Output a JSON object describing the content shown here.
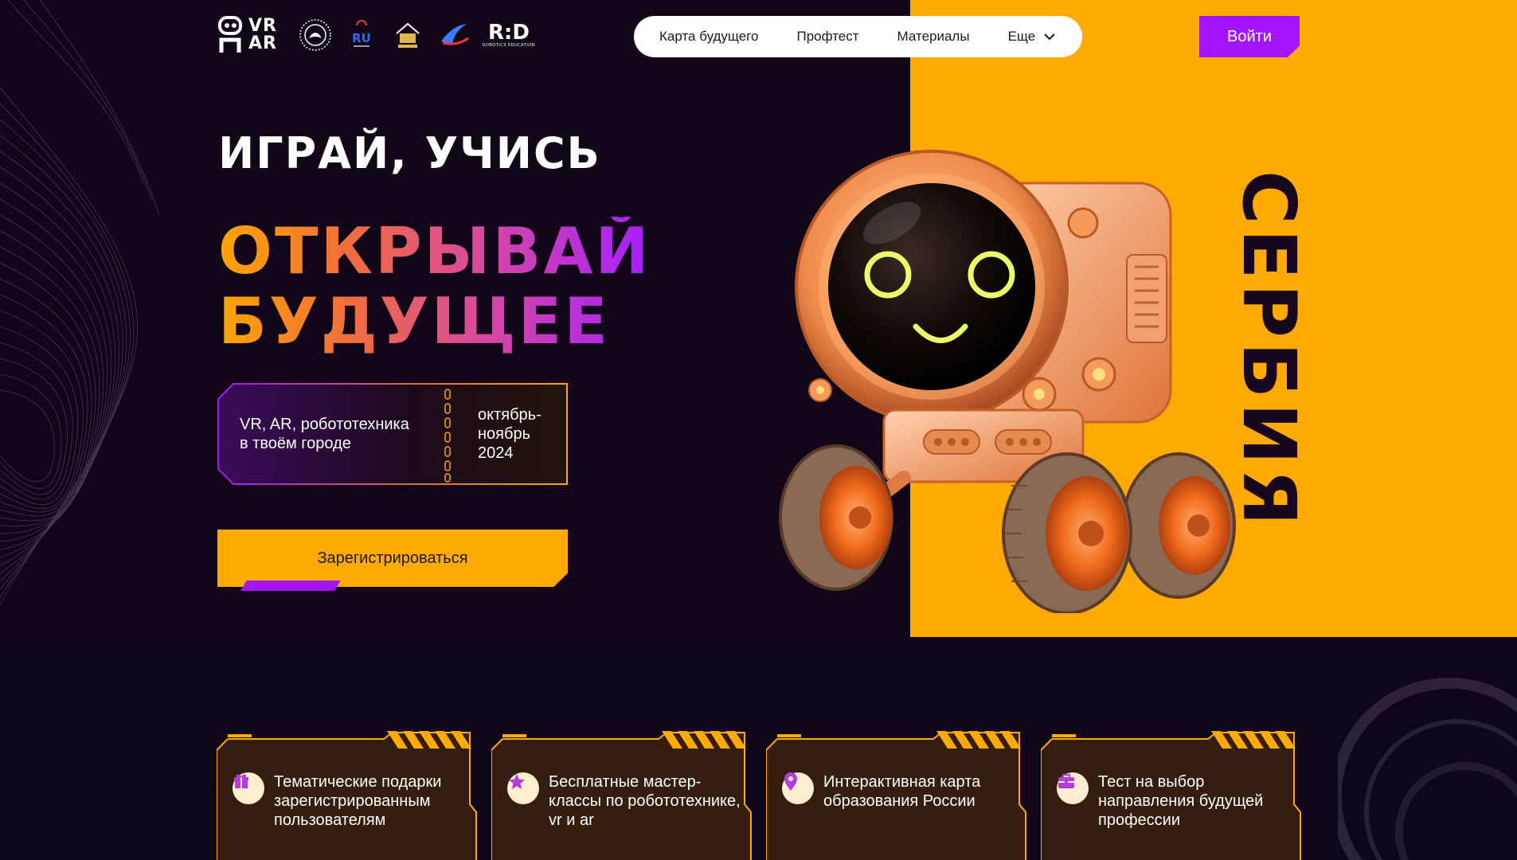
{
  "header": {
    "logos": {
      "vrar_top": "VR",
      "vrar_bottom": "AR",
      "ru_mark": "RU",
      "rid_title": "R:D",
      "rid_caption": "ROBOTICS EDUCATION"
    },
    "nav": {
      "items": [
        {
          "label": "Карта будущего"
        },
        {
          "label": "Профтест"
        },
        {
          "label": "Материалы"
        },
        {
          "label": "Еще"
        }
      ]
    },
    "login_label": "Войти"
  },
  "hero": {
    "subtitle": "ИГРАЙ, УЧИСЬ",
    "title_line1": "ОТКРЫВАЙ",
    "title_line2": "БУДУЩЕЕ",
    "ticket_left": "VR, AR, робототехника в твоём городе",
    "ticket_right": "октябрь-ноябрь 2024",
    "register_label": "Зарегистрироваться",
    "side_word": "СЕРБИЯ"
  },
  "features": [
    {
      "icon": "gift-icon",
      "text": "Тематические подарки зарегистрированным пользователям"
    },
    {
      "icon": "star-icon",
      "text": "Бесплатные мастер-классы по робототехнике, vr и ar"
    },
    {
      "icon": "location-pin-icon",
      "text": "Интерактивная карта образования России"
    },
    {
      "icon": "briefcase-icon",
      "text": "Тест на выбор направления будущей профессии"
    }
  ],
  "colors": {
    "background": "#110718",
    "accent_orange": "#ffaa00",
    "accent_purple": "#a314ff",
    "card_bg": "#3a2010"
  }
}
